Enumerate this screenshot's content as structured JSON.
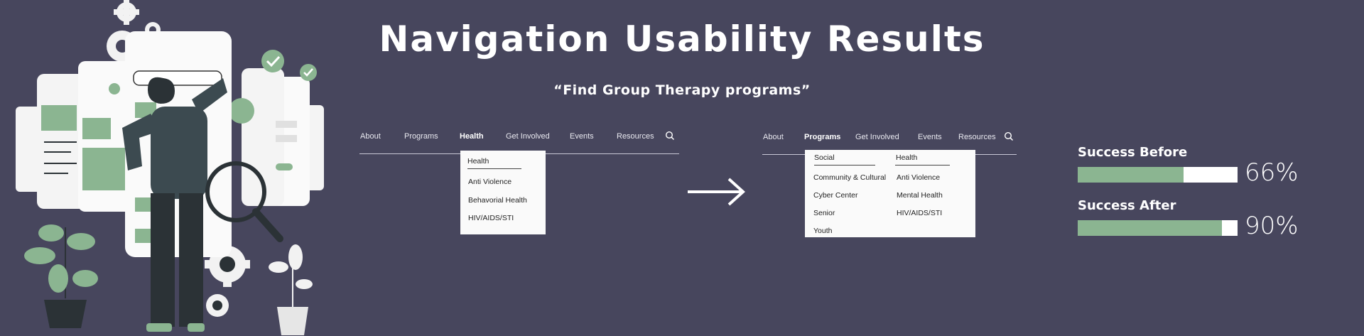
{
  "header": {
    "title": "Navigation Usability Results",
    "subtitle": "“Find Group Therapy programs”"
  },
  "before_nav": {
    "items": [
      "About",
      "Programs",
      "Health",
      "Get Involved",
      "Events",
      "Resources"
    ],
    "active": "Health",
    "dropdown": {
      "heading": "Health",
      "items": [
        "Anti Violence",
        "Behavorial Health",
        "HIV/AIDS/STI"
      ]
    }
  },
  "after_nav": {
    "items": [
      "About",
      "Programs",
      "Get Involved",
      "Events",
      "Resources"
    ],
    "active": "Programs",
    "dropdown": {
      "col1_heading": "Social",
      "col1_items": [
        "Community & Cultural",
        "Cyber Center",
        "Senior",
        "Youth"
      ],
      "col2_heading": "Health",
      "col2_items": [
        "Anti Violence",
        "Mental Health",
        "HIV/AIDS/STI"
      ]
    }
  },
  "results": {
    "before": {
      "label": "Success Before",
      "value": 0.66,
      "text": "66%"
    },
    "after": {
      "label": "Success After",
      "value": 0.9,
      "text": "90%"
    }
  },
  "colors": {
    "background": "#47465d",
    "accent_green": "#8bb591",
    "dark_figure": "#2b3236",
    "panel": "#f4f4f4"
  },
  "icons": [
    "gear-icon",
    "checkmark-icon",
    "magnifier-icon",
    "search-icon",
    "arrow-right-icon",
    "plant-icon",
    "person-icon"
  ]
}
